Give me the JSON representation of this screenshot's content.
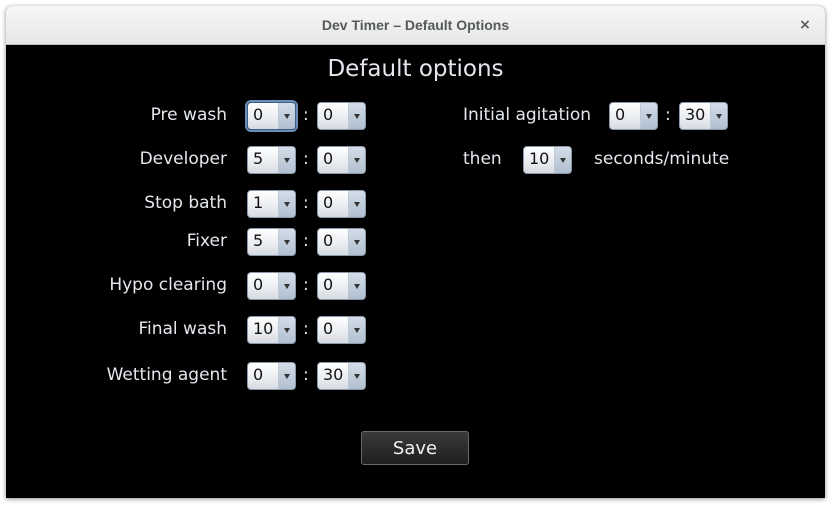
{
  "window": {
    "title": "Dev Timer – Default Options",
    "close_glyph": "×"
  },
  "heading": "Default options",
  "separator": ":",
  "rows": [
    {
      "label": "Pre wash",
      "minutes": "0",
      "seconds": "0"
    },
    {
      "label": "Developer",
      "minutes": "5",
      "seconds": "0"
    },
    {
      "label": "Stop bath",
      "minutes": "1",
      "seconds": "0"
    },
    {
      "label": "Fixer",
      "minutes": "5",
      "seconds": "0"
    },
    {
      "label": "Hypo clearing",
      "minutes": "0",
      "seconds": "0"
    },
    {
      "label": "Final wash",
      "minutes": "10",
      "seconds": "0"
    },
    {
      "label": "Wetting agent",
      "minutes": "0",
      "seconds": "30"
    }
  ],
  "agitation": {
    "label": "Initial agitation",
    "minutes": "0",
    "seconds": "30",
    "then_label": "then",
    "interval": "10",
    "unit_label": "seconds/minute"
  },
  "save_label": "Save"
}
